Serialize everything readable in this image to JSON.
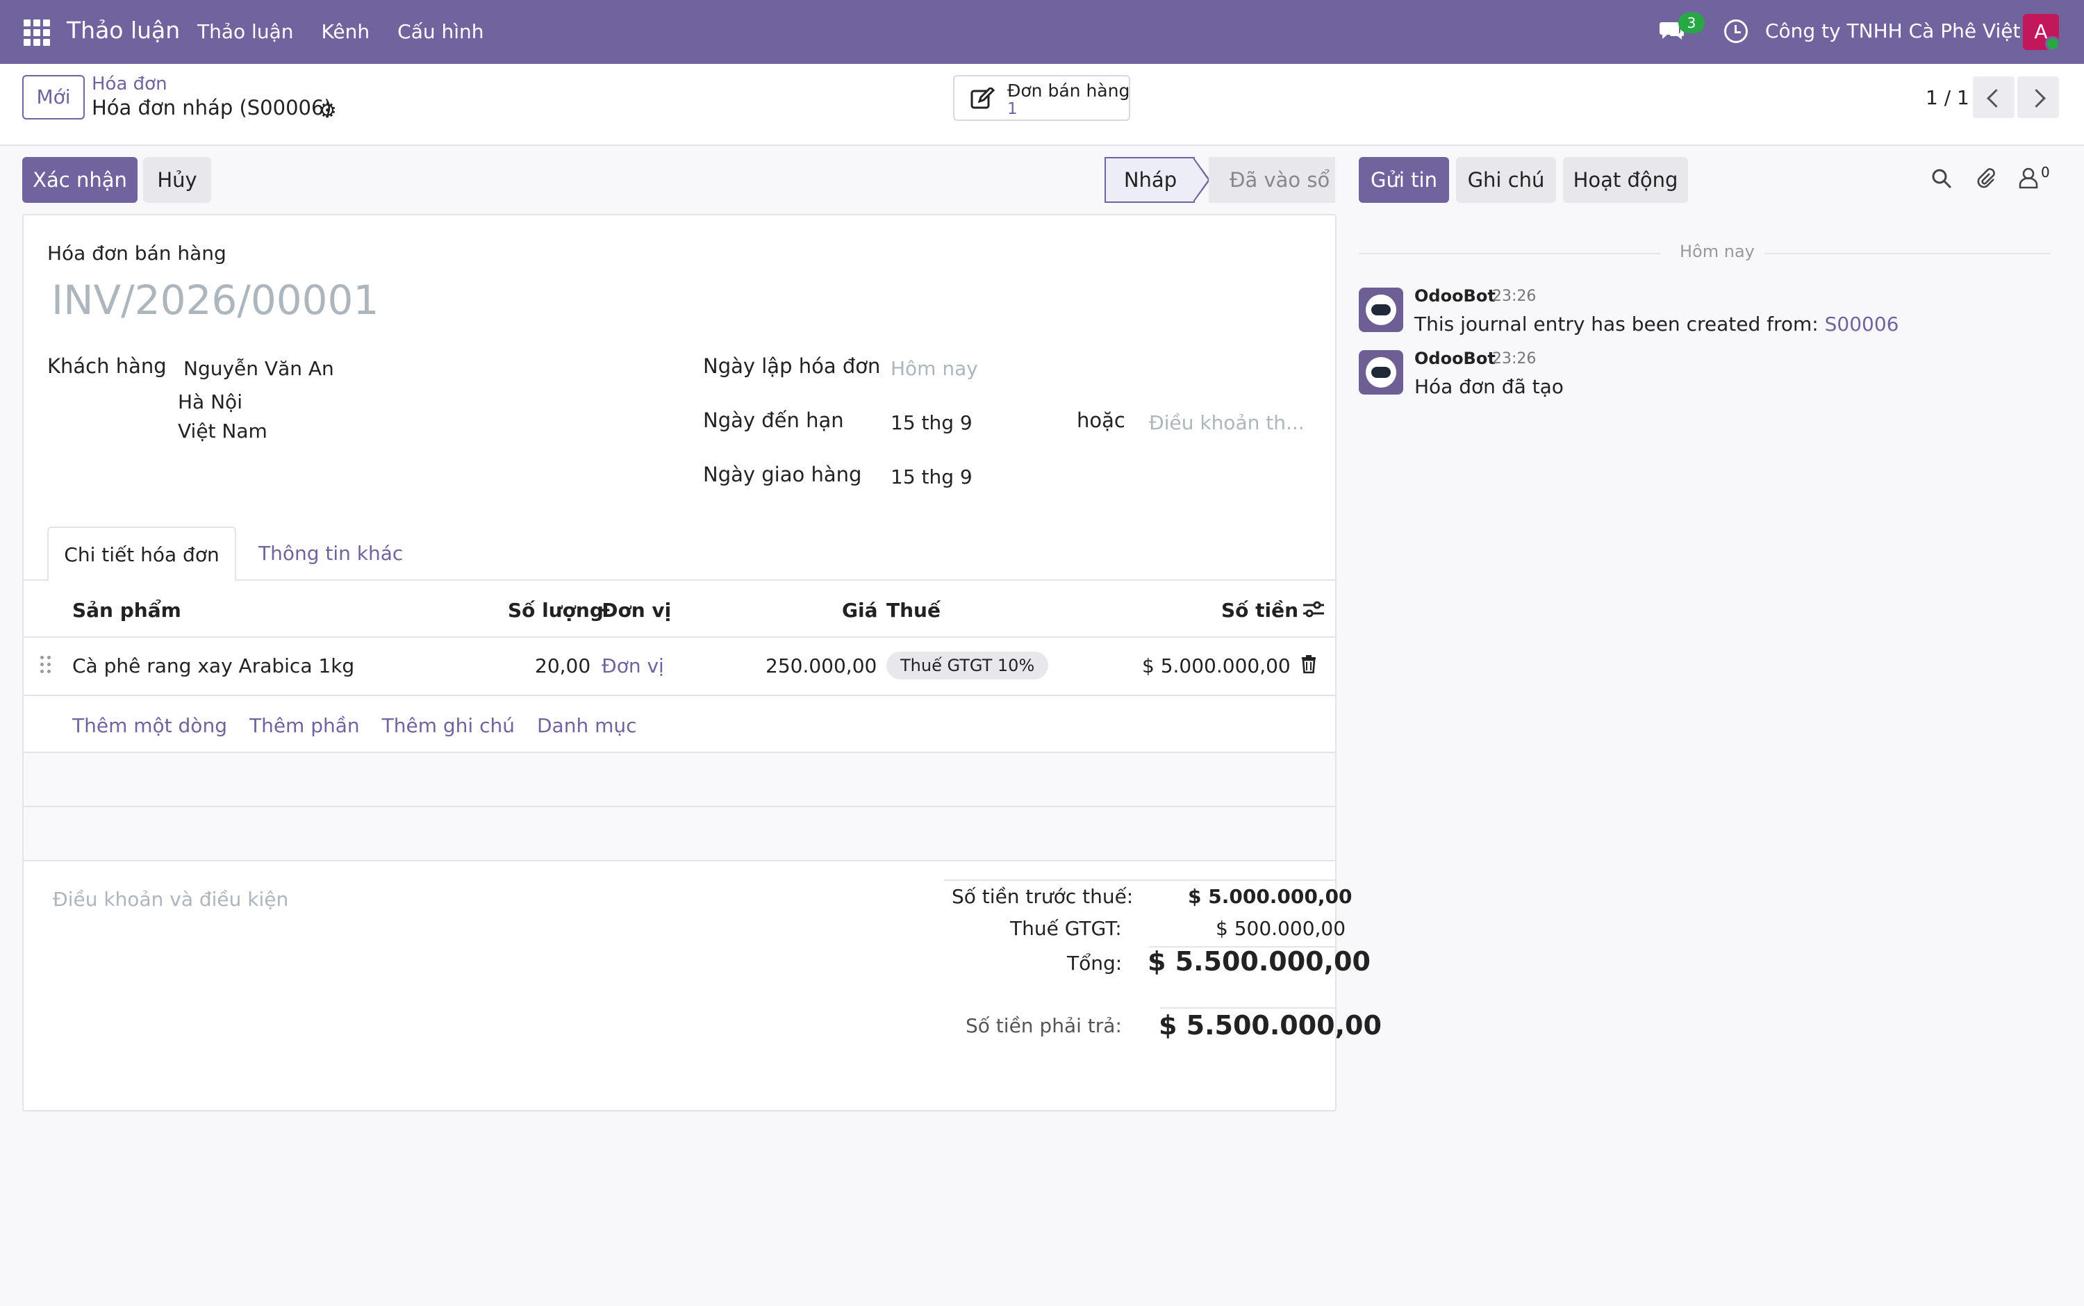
{
  "navbar": {
    "app_title": "Thảo luận",
    "menu": [
      "Thảo luận",
      "Kênh",
      "Cấu hình"
    ],
    "chat_badge": "3",
    "company": "Công ty TNHH Cà Phê Việt",
    "avatar_initial": "A"
  },
  "control_panel": {
    "new_label": "Mới",
    "breadcrumb_parent": "Hóa đơn",
    "breadcrumb_current": "Hóa đơn nháp (S00006)",
    "smart_button_label": "Đơn bán hàng",
    "smart_button_value": "1",
    "pager": "1 / 1"
  },
  "actions": {
    "confirm": "Xác nhận",
    "cancel": "Hủy",
    "status_draft": "Nháp",
    "status_posted": "Đã vào sổ"
  },
  "chatter": {
    "send_message": "Gửi tin",
    "log_note": "Ghi chú",
    "activity": "Hoạt động",
    "follower_count": "0",
    "day_separator": "Hôm nay",
    "messages": [
      {
        "author": "OdooBot",
        "time": "23:26",
        "body": "This journal entry has been created from: ",
        "link": "S00006"
      },
      {
        "author": "OdooBot",
        "time": "23:26",
        "body": "Hóa đơn đã tạo",
        "link": ""
      }
    ]
  },
  "form": {
    "doc_type": "Hóa đơn bán hàng",
    "doc_name": "INV/2026/00001",
    "customer_label": "Khách hàng",
    "customer_name": "Nguyễn Văn An",
    "customer_city": "Hà Nội",
    "customer_country": "Việt Nam",
    "invoice_date_label": "Ngày lập hóa đơn",
    "invoice_date_placeholder": "Hôm nay",
    "due_date_label": "Ngày đến hạn",
    "due_date_value": "15 thg 9",
    "or_label": "hoặc",
    "payment_terms_placeholder": "Điều khoản th...",
    "delivery_date_label": "Ngày giao hàng",
    "delivery_date_value": "15 thg 9",
    "tabs": [
      "Chi tiết hóa đơn",
      "Thông tin khác"
    ]
  },
  "lines": {
    "headers": {
      "product": "Sản phẩm",
      "quantity": "Số lượng",
      "uom": "Đơn vị",
      "price": "Giá",
      "taxes": "Thuế",
      "subtotal": "Số tiền"
    },
    "rows": [
      {
        "product": "Cà phê rang xay Arabica 1kg",
        "quantity": "20,00",
        "uom": "Đơn vị",
        "price": "250.000,00",
        "tax": "Thuế GTGT 10%",
        "subtotal": "$ 5.000.000,00"
      }
    ],
    "add_links": [
      "Thêm một dòng",
      "Thêm phần",
      "Thêm ghi chú",
      "Danh mục"
    ]
  },
  "totals": {
    "terms_placeholder": "Điều khoản và điều kiện",
    "untaxed_label": "Số tiền trước thuế:",
    "untaxed_value": "$ 5.000.000,00",
    "vat_label": "Thuế GTGT:",
    "vat_value": "$ 500.000,00",
    "total_label": "Tổng:",
    "total_value": "$ 5.500.000,00",
    "due_label": "Số tiền phải trả:",
    "due_value": "$ 5.500.000,00"
  }
}
